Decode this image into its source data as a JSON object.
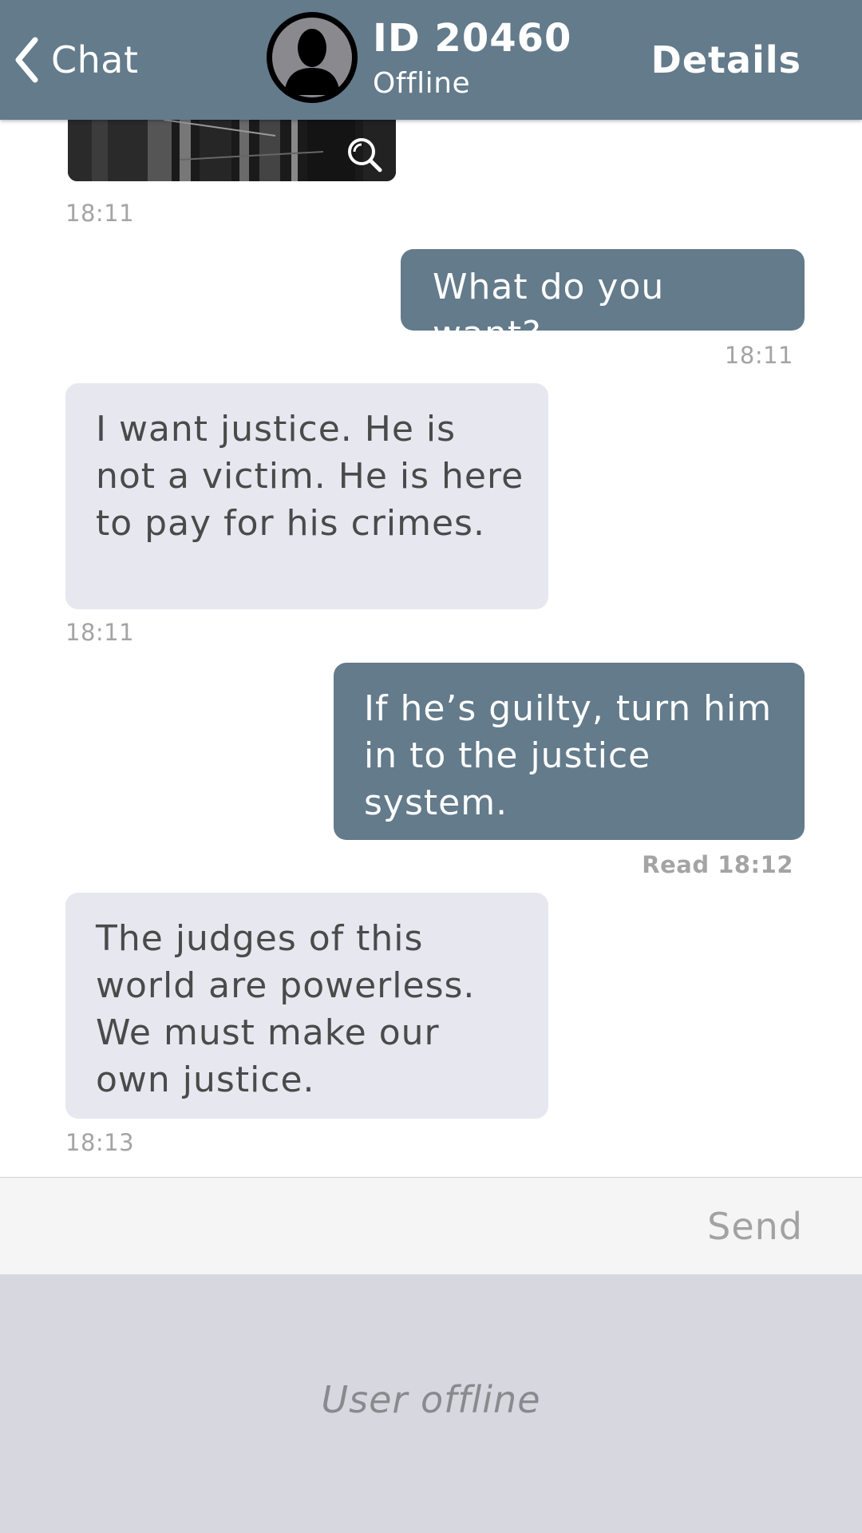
{
  "header": {
    "back_label": "Chat",
    "contact_name": "ID 20460",
    "contact_status": "Offline",
    "details_label": "Details",
    "background_color": "#637b8b",
    "icons": {
      "back": "chevron-left-icon",
      "avatar": "person-silhouette-icon"
    }
  },
  "messages": [
    {
      "kind": "image",
      "direction": "incoming",
      "time": "18:11",
      "icon": "zoom-icon"
    },
    {
      "kind": "text",
      "direction": "outgoing",
      "text": "What do you want?",
      "time": "18:11"
    },
    {
      "kind": "text",
      "direction": "incoming",
      "text": "I want justice. He is not a victim. He is here to pay for his crimes.",
      "time": "18:11"
    },
    {
      "kind": "text",
      "direction": "outgoing",
      "text": "If he’s guilty, turn him in to the justice system.",
      "time": "Read 18:12"
    },
    {
      "kind": "text",
      "direction": "incoming",
      "text": "The judges of this world are powerless. We must make our own justice.",
      "time": "18:13"
    }
  ],
  "colors": {
    "outgoing_bubble": "#637b8b",
    "incoming_bubble": "#e6e7ef",
    "timestamp": "#a4a4a4",
    "offline_panel": "#d7d7e0"
  },
  "composer": {
    "send_label": "Send"
  },
  "offline_panel": {
    "message": "User offline"
  }
}
